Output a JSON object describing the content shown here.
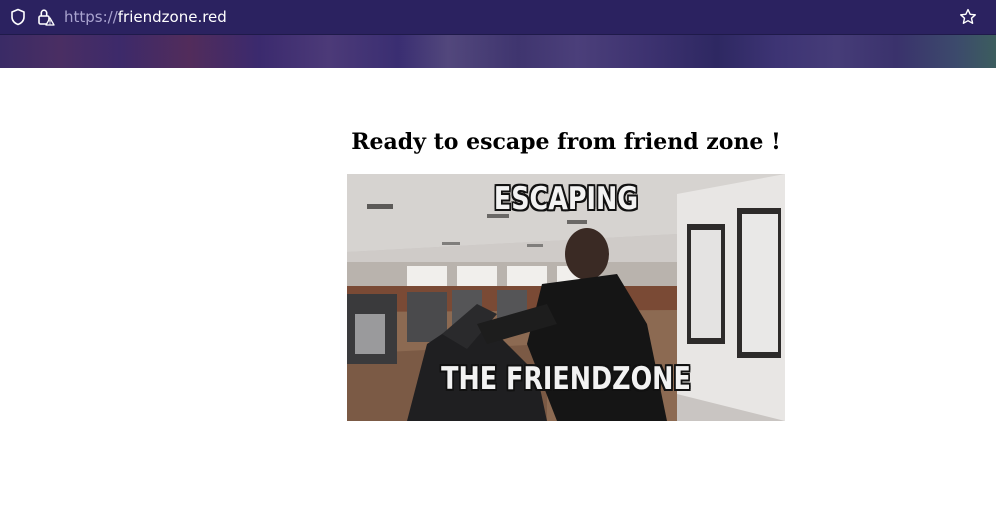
{
  "browser": {
    "url_scheme": "https://",
    "url_host": "friendzone.red",
    "icons": {
      "shield": "shield-icon",
      "lock": "lock-warning-icon",
      "bookmark": "star-icon"
    },
    "colors": {
      "toolbar": "#2b2260",
      "url_scheme": "#a9a3cf"
    }
  },
  "page": {
    "heading": "Ready to escape from friend zone !",
    "meme": {
      "top_text": "ESCAPING",
      "bottom_text": "THE FRIENDZONE"
    }
  }
}
